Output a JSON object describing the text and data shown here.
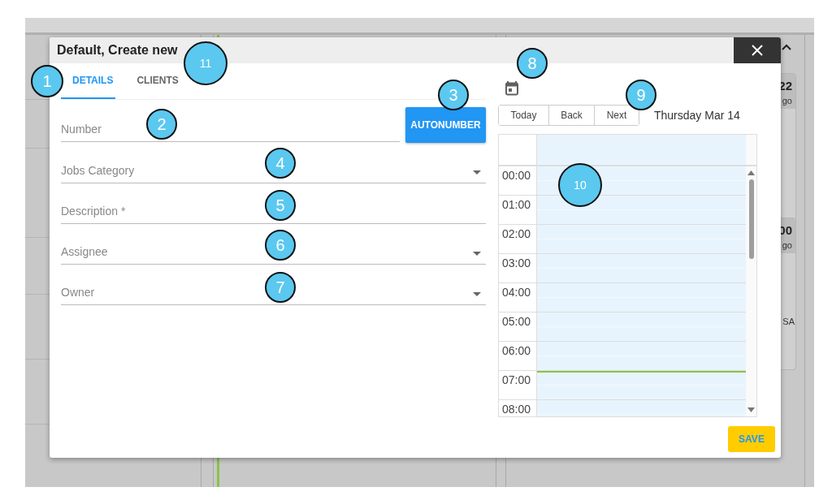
{
  "background": {
    "cards": [
      {
        "title": "22",
        "subtitle": "go"
      },
      {
        "title": "00",
        "subtitle": "go",
        "rows": [
          "SA"
        ]
      }
    ]
  },
  "dialog": {
    "title": "Default, Create new",
    "tabs": [
      {
        "label": "DETAILS",
        "selected": true
      },
      {
        "label": "CLIENTS",
        "selected": false
      }
    ],
    "number_field": {
      "placeholder": "Number",
      "button": "AUTONUMBER"
    },
    "fields": [
      {
        "kind": "select",
        "placeholder": "Jobs Category"
      },
      {
        "kind": "text",
        "placeholder": "Description *"
      },
      {
        "kind": "select",
        "placeholder": "Assignee"
      },
      {
        "kind": "select",
        "placeholder": "Owner"
      }
    ],
    "calendar": {
      "toolbar": [
        "Today",
        "Back",
        "Next"
      ],
      "date_label": "Thursday Mar 14",
      "times": [
        "00:00",
        "01:00",
        "02:00",
        "03:00",
        "04:00",
        "05:00",
        "06:00",
        "07:00",
        "08:00"
      ]
    },
    "save_button": "SAVE"
  },
  "callouts": [
    "1",
    "11",
    "2",
    "3",
    "4",
    "5",
    "6",
    "7",
    "8",
    "9",
    "10"
  ]
}
